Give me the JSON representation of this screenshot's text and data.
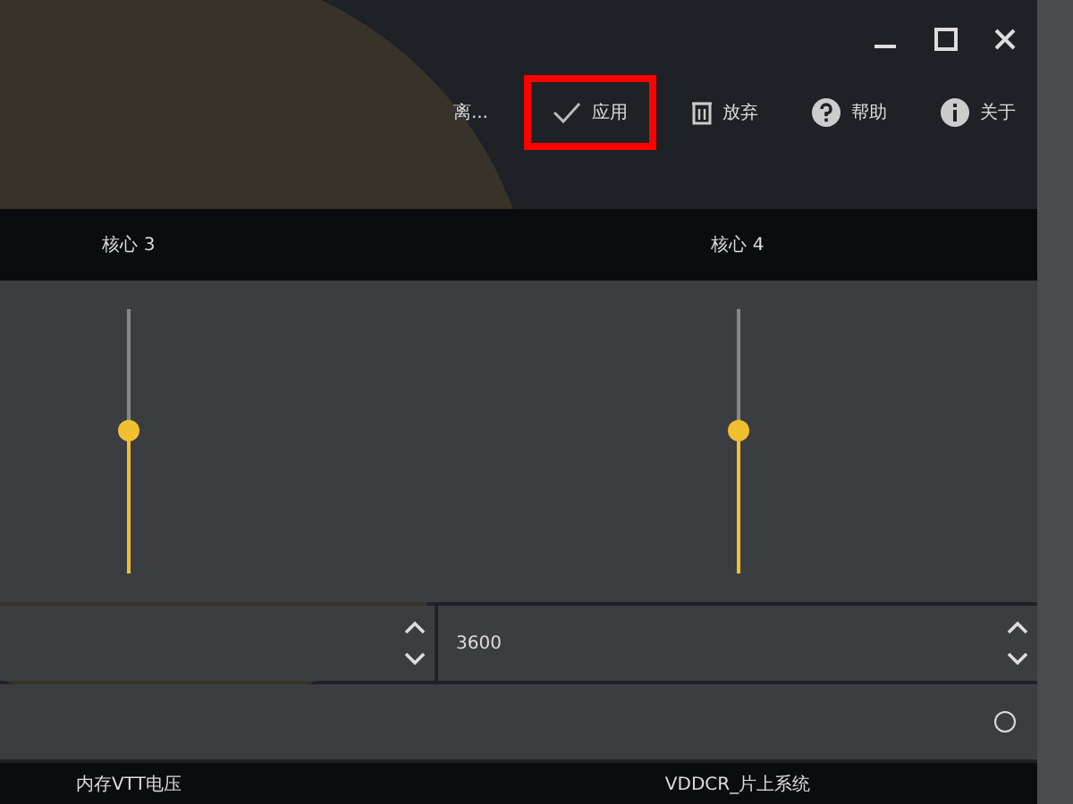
{
  "toolbar": [
    {
      "kind": "text",
      "label": "离...",
      "highlighted": false
    },
    {
      "kind": "check",
      "label": "应用",
      "highlighted": true
    },
    {
      "kind": "trash",
      "label": "放弃",
      "highlighted": false
    },
    {
      "kind": "help",
      "label": "帮助",
      "highlighted": false
    },
    {
      "kind": "info",
      "label": "关于",
      "highlighted": false
    }
  ],
  "cores": [
    {
      "label": "核心 3",
      "level": 0.5
    },
    {
      "label": "核心 4",
      "level": 0.5,
      "value": "3600"
    }
  ],
  "option_row": {
    "selected": false
  },
  "bottom_headers": [
    "内存VTT电压",
    "VDDCR_片上系统"
  ]
}
